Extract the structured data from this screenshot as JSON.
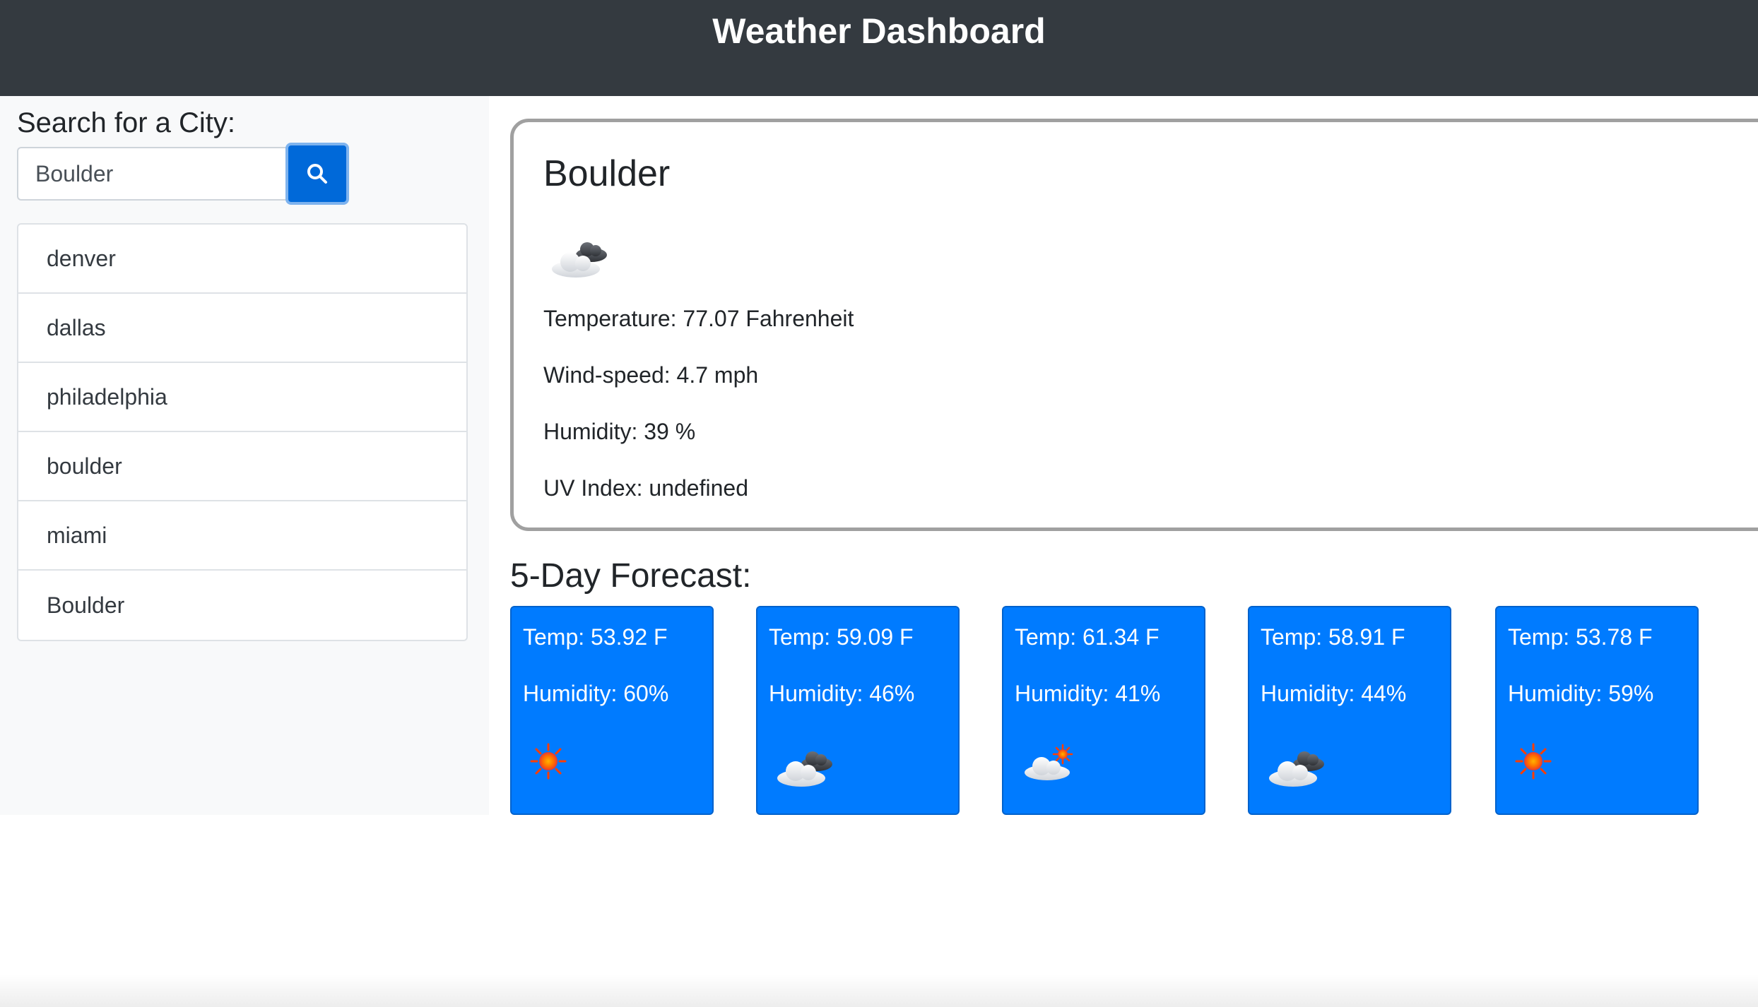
{
  "header": {
    "title": "Weather Dashboard"
  },
  "search": {
    "heading": "Search for a City:",
    "input_value": "Boulder",
    "button_icon": "search-icon"
  },
  "history": {
    "items": [
      {
        "label": "denver"
      },
      {
        "label": "dallas"
      },
      {
        "label": "philadelphia"
      },
      {
        "label": "boulder"
      },
      {
        "label": "miami"
      },
      {
        "label": "Boulder"
      }
    ]
  },
  "current": {
    "city": "Boulder",
    "icon": "partly-cloudy-icon",
    "temperature": "Temperature: 77.07 Fahrenheit",
    "wind": "Wind-speed: 4.7 mph",
    "humidity": "Humidity: 39 %",
    "uv": "UV Index: undefined"
  },
  "forecast": {
    "heading": "5-Day Forecast:",
    "days": [
      {
        "temp": "Temp: 53.92 F",
        "humidity": "Humidity: 60%",
        "icon": "sun-icon"
      },
      {
        "temp": "Temp: 59.09 F",
        "humidity": "Humidity: 46%",
        "icon": "cloud-icon"
      },
      {
        "temp": "Temp: 61.34 F",
        "humidity": "Humidity: 41%",
        "icon": "sun-behind-cloud-icon"
      },
      {
        "temp": "Temp: 58.91 F",
        "humidity": "Humidity: 44%",
        "icon": "cloud-icon"
      },
      {
        "temp": "Temp: 53.78 F",
        "humidity": "Humidity: 59%",
        "icon": "sun-icon"
      }
    ]
  },
  "colors": {
    "navbar": "#343a40",
    "sidebar": "#f8f9fa",
    "primary": "#007bff",
    "search_button": "#0069d9"
  }
}
